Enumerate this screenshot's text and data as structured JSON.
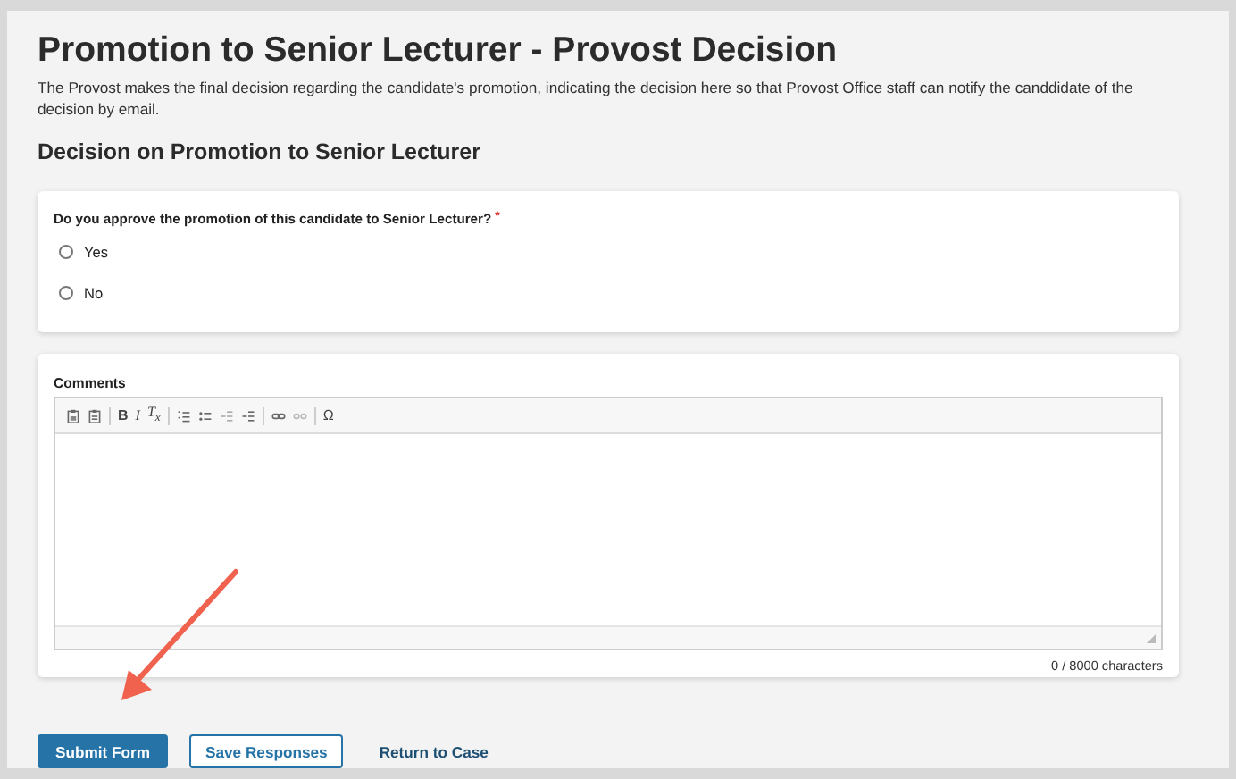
{
  "title": "Promotion to Senior Lecturer - Provost Decision",
  "description": "The Provost makes the final decision regarding the candidate's promotion, indicating the decision here so that Provost Office staff can notify the canddidate of the decision by email.",
  "section_title": "Decision on Promotion to Senior Lecturer",
  "question": {
    "label": "Do you approve the promotion of this candidate to Senior Lecturer?",
    "required_mark": "*",
    "options": [
      {
        "label": "Yes",
        "selected": false
      },
      {
        "label": "No",
        "selected": false
      }
    ]
  },
  "comments": {
    "label": "Comments",
    "toolbar_glyphs": [
      "B",
      "I",
      "T$_{x}$",
      "Ω"
    ],
    "counter": "0 / 8000 characters"
  },
  "buttons": [
    {
      "label": "Submit Form",
      "kind": "primary"
    },
    {
      "label": "Save Responses",
      "kind": "secondary"
    },
    {
      "label": "Return to Case",
      "kind": "link"
    }
  ]
}
